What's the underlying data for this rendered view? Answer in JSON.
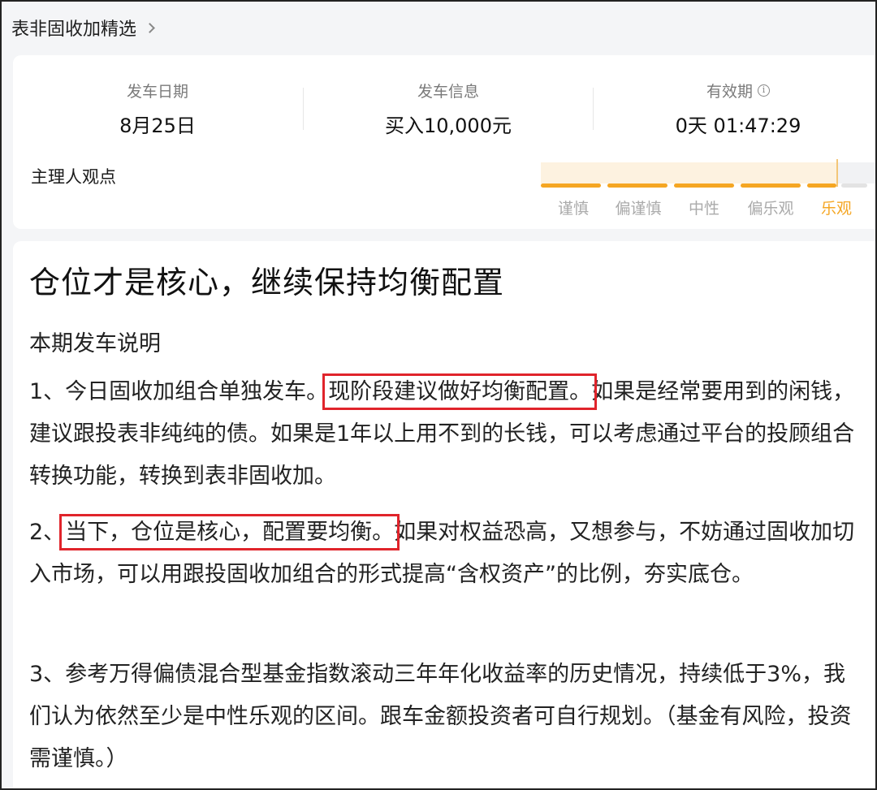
{
  "header": {
    "title": "表非固收加精选"
  },
  "stats": [
    {
      "label": "发车日期",
      "value": "8月25日"
    },
    {
      "label": "发车信息",
      "value": "买入10,000元"
    },
    {
      "label": "有效期",
      "value": "0天 01:47:29"
    }
  ],
  "manager": {
    "label": "主理人观点",
    "levels": [
      "谨慎",
      "偏谨慎",
      "中性",
      "偏乐观",
      "乐观"
    ],
    "selected": "乐观",
    "accent": "#f5a623"
  },
  "article": {
    "headline": "仓位才是核心，继续保持均衡配置",
    "subhead": "本期发车说明",
    "p1": {
      "prefix": "1、今日固收加组合单独发车。",
      "highlight": "现阶段建议做好均衡配置。",
      "rest": "如果是经常要用到的闲钱，建议跟投表非纯纯的债。如果是1年以上用不到的长钱，可以考虑通过平台的投顾组合转换功能，转换到表非固收加。"
    },
    "p2": {
      "prefix": "2、",
      "highlight": "当下，仓位是核心，配置要均衡。",
      "rest": "如果对权益恐高，又想参与，不妨通过固收加切入市场，可以用跟投固收加组合的形式提高“含权资产”的比例，夯实底仓。"
    },
    "p3": "3、参考万得偏债混合型基金指数滚动三年年化收益率的历史情况，持续低于3%，我们认为依然至少是中性乐观的区间。跟车金额投资者可自行规划。（基金有风险，投资需谨慎。）",
    "highlight_color": "#e0242b"
  }
}
